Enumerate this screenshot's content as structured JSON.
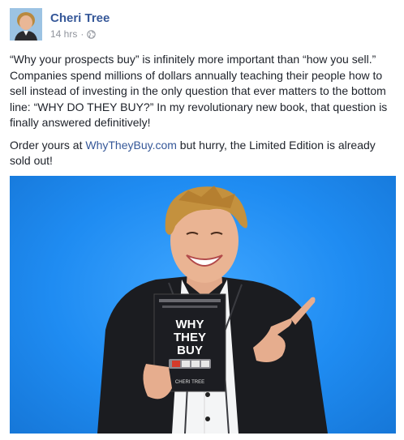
{
  "post": {
    "author": "Cheri Tree",
    "time": "14 hrs",
    "separator": "·",
    "paragraph1": "“Why your prospects buy” is infinitely more important than “how you sell.” Companies spend millions of dollars annually teaching their people how to sell instead of investing in the only question that ever matters to the bottom line: “WHY DO THEY BUY?” In my revolutionary new book, that question is finally answered definitively!",
    "paragraph2_before": "Order yours at ",
    "link_text": "WhyTheyBuy.com",
    "paragraph2_after": " but hurry, the Limited Edition is already sold out!",
    "privacy_icon": "globe-icon"
  },
  "book": {
    "title_line1": "WHY",
    "title_line2": "THEY",
    "title_line3": "BUY",
    "author": "CHERI TREE"
  },
  "colors": {
    "link": "#365899",
    "meta": "#90949c",
    "photo_background": "#1f8cf2"
  }
}
